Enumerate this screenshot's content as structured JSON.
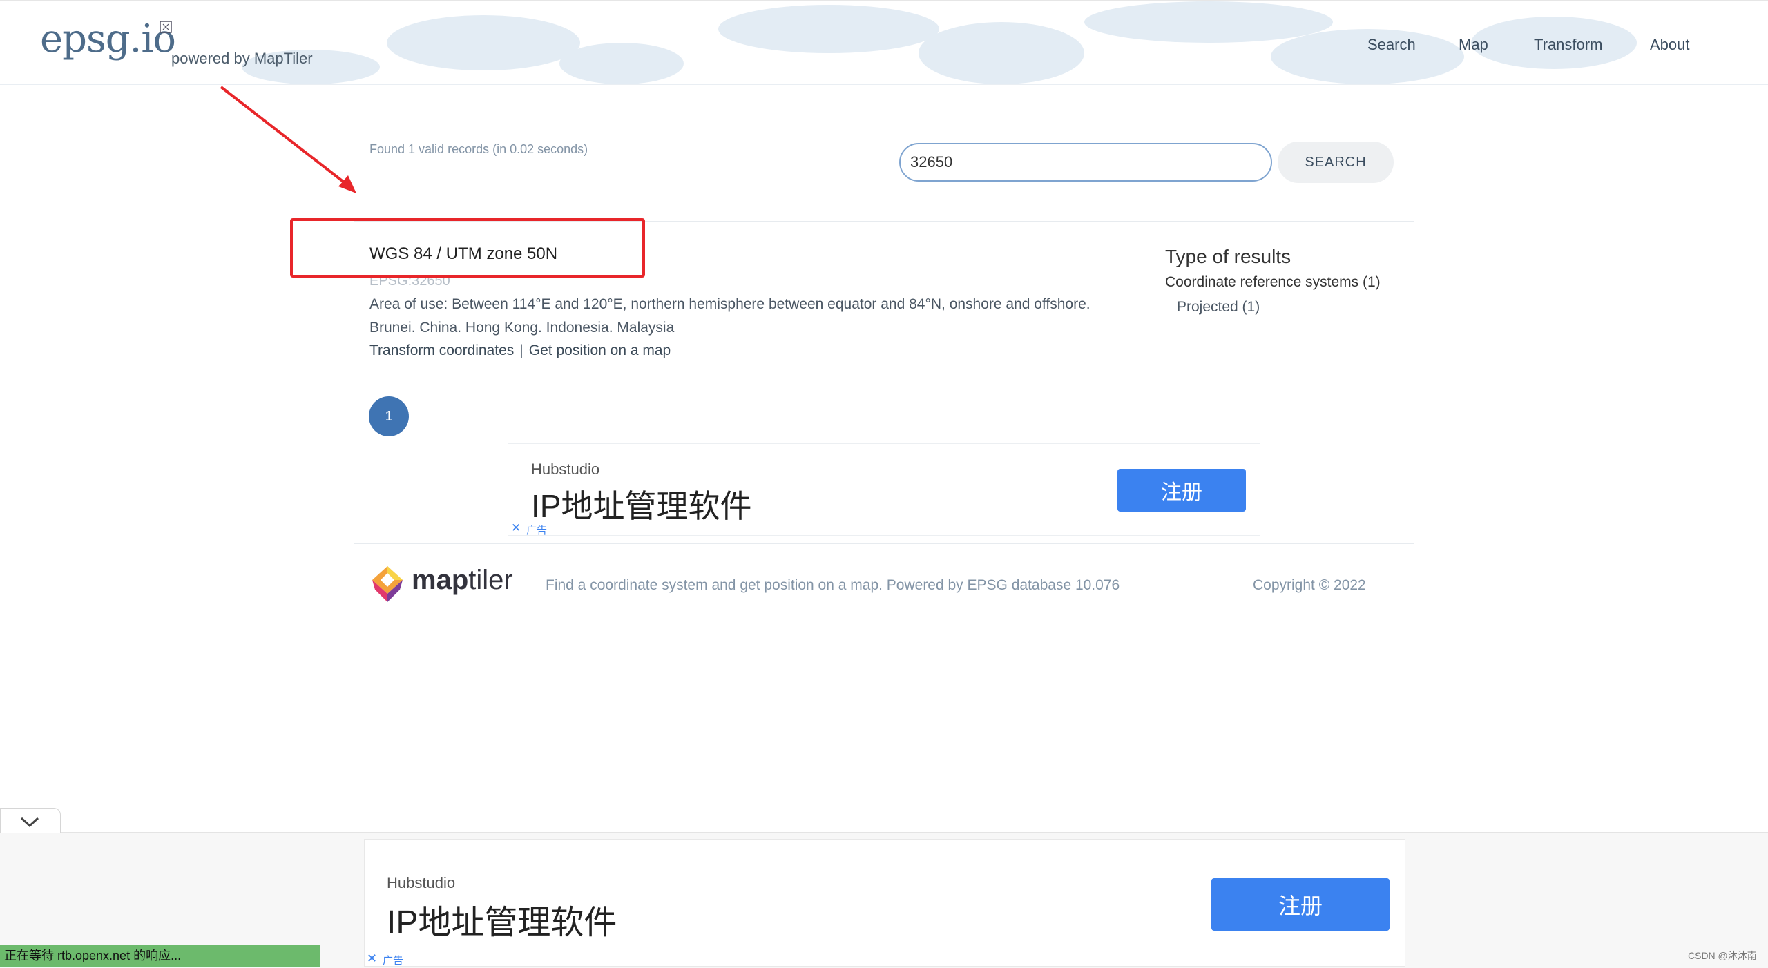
{
  "header": {
    "logo_text": "epsg.io",
    "powered_by": "powered by MapTiler",
    "nav": [
      {
        "label": "Search"
      },
      {
        "label": "Map"
      },
      {
        "label": "Transform"
      },
      {
        "label": "About"
      }
    ]
  },
  "search": {
    "found_text": "Found 1 valid records (in 0.02 seconds)",
    "query_value": "32650",
    "button_label": "SEARCH"
  },
  "result": {
    "title": "WGS 84 / UTM zone 50N",
    "code": "EPSG:32650",
    "area": "Area of use: Between 114°E and 120°E, northern hemisphere between equator and 84°N, onshore and offshore.",
    "countries": "Brunei. China. Hong Kong. Indonesia. Malaysia",
    "link_transform": "Transform coordinates",
    "link_separator": "|",
    "link_map": "Get position on a map"
  },
  "filters": {
    "title": "Type of results",
    "crs": "Coordinate reference systems (1)",
    "projected": "Projected (1)"
  },
  "pagination": {
    "current": "1"
  },
  "ad_inline": {
    "brand": "Hubstudio",
    "title": "IP地址管理软件",
    "button": "注册",
    "close": "✕",
    "ad_label": "广告"
  },
  "footer": {
    "logo_bold": "map",
    "logo_light": "tiler",
    "description": "Find a coordinate system and get position on a map. Powered by EPSG database 10.076",
    "copyright": "Copyright © 2022"
  },
  "bottom_ad": {
    "brand": "Hubstudio",
    "title": "IP地址管理软件",
    "button": "注册",
    "close": "✕",
    "ad_label": "广告"
  },
  "status": {
    "text": "正在等待 rtb.openx.net 的响应..."
  },
  "watermark": {
    "text": "CSDN @沐沐南"
  },
  "colors": {
    "accent": "#3f74b3",
    "annotation_red": "#e8262a",
    "ad_button": "#3b82f0",
    "status_green": "#6cba6c"
  }
}
